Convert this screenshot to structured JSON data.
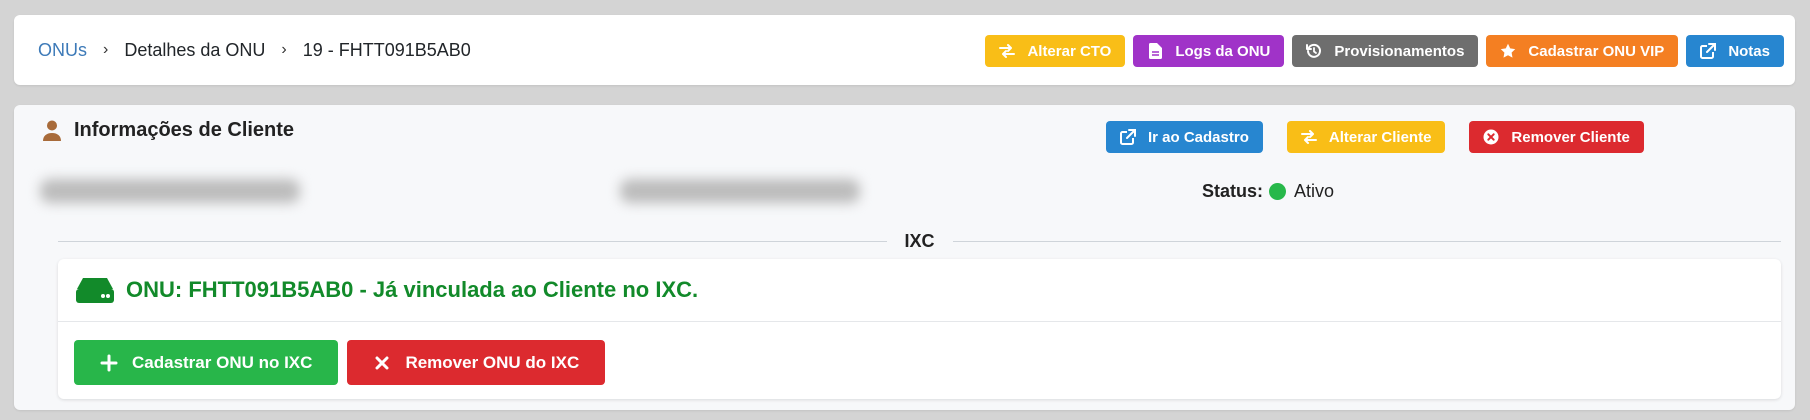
{
  "breadcrumb": {
    "root": "ONUs",
    "sep": "›",
    "level2": "Detalhes da ONU",
    "current": "19 - FHTT091B5AB0"
  },
  "top_actions": {
    "alterar_cto": "Alterar CTO",
    "logs": "Logs da ONU",
    "provisionamentos": "Provisionamentos",
    "cadastrar_vip": "Cadastrar ONU VIP",
    "notas": "Notas"
  },
  "client_panel": {
    "title": "Informações de Cliente",
    "ir_cadastro": "Ir ao Cadastro",
    "alterar_cliente": "Alterar Cliente",
    "remover_cliente": "Remover Cliente",
    "status_label": "Status:",
    "status_value": "Ativo",
    "status_color": "#27b84a"
  },
  "ixc": {
    "section_label": "IXC",
    "message": "ONU: FHTT091B5AB0 - Já vinculada ao Cliente no IXC.",
    "cadastrar": "Cadastrar ONU no IXC",
    "remover": "Remover ONU do IXC"
  },
  "icons": [
    "exchange-icon",
    "file-icon",
    "history-icon",
    "star-icon",
    "external-link-icon",
    "user-icon",
    "x-circle-icon",
    "hdd-icon",
    "plus-icon",
    "times-icon"
  ]
}
